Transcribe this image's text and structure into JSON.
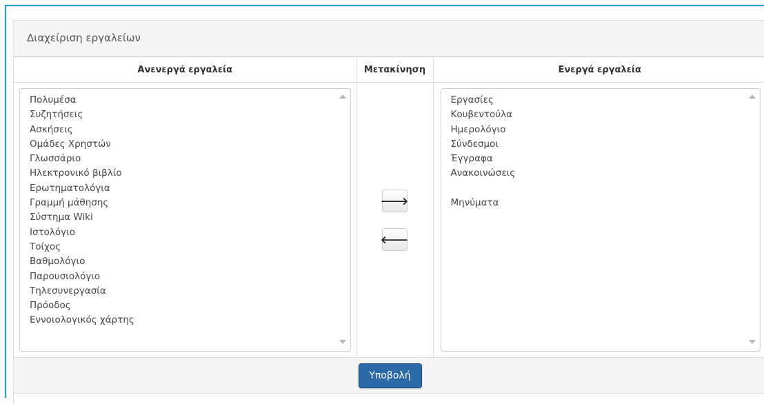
{
  "panel": {
    "title": "Διαχείριση εργαλείων"
  },
  "columns": {
    "inactive": "Ανενεργά εργαλεία",
    "move": "Μετακίνηση",
    "active": "Ενεργά εργαλεία"
  },
  "inactive_tools": [
    "Πολυμέσα",
    "Συζητήσεις",
    "Ασκήσεις",
    "Ομάδες Χρηστών",
    "Γλωσσάριο",
    "Ηλεκτρονικό βιβλίο",
    "Ερωτηματολόγια",
    "Γραμμή μάθησης",
    "Σύστημα Wiki",
    "Ιστολόγιο",
    "Τοίχος",
    "Βαθμολόγιο",
    "Παρουσιολόγιο",
    "Τηλεσυνεργασία",
    "Πρόοδος",
    "Εννοιολογικός χάρτης"
  ],
  "active_tools": [
    "Εργασίες",
    "Κουβεντούλα",
    "Ημερολόγιο",
    "Σύνδεσμοι",
    "Έγγραφα",
    "Ανακοινώσεις",
    "",
    "Μηνύματα"
  ],
  "buttons": {
    "move_right": "🡒",
    "move_left": "🡐",
    "submit": "Υποβολή"
  },
  "icons": {
    "move_right": "arrow-right-icon",
    "move_left": "arrow-left-icon"
  },
  "colors": {
    "frame_border": "#1f9bd1",
    "submit_bg": "#2b6aa6"
  }
}
